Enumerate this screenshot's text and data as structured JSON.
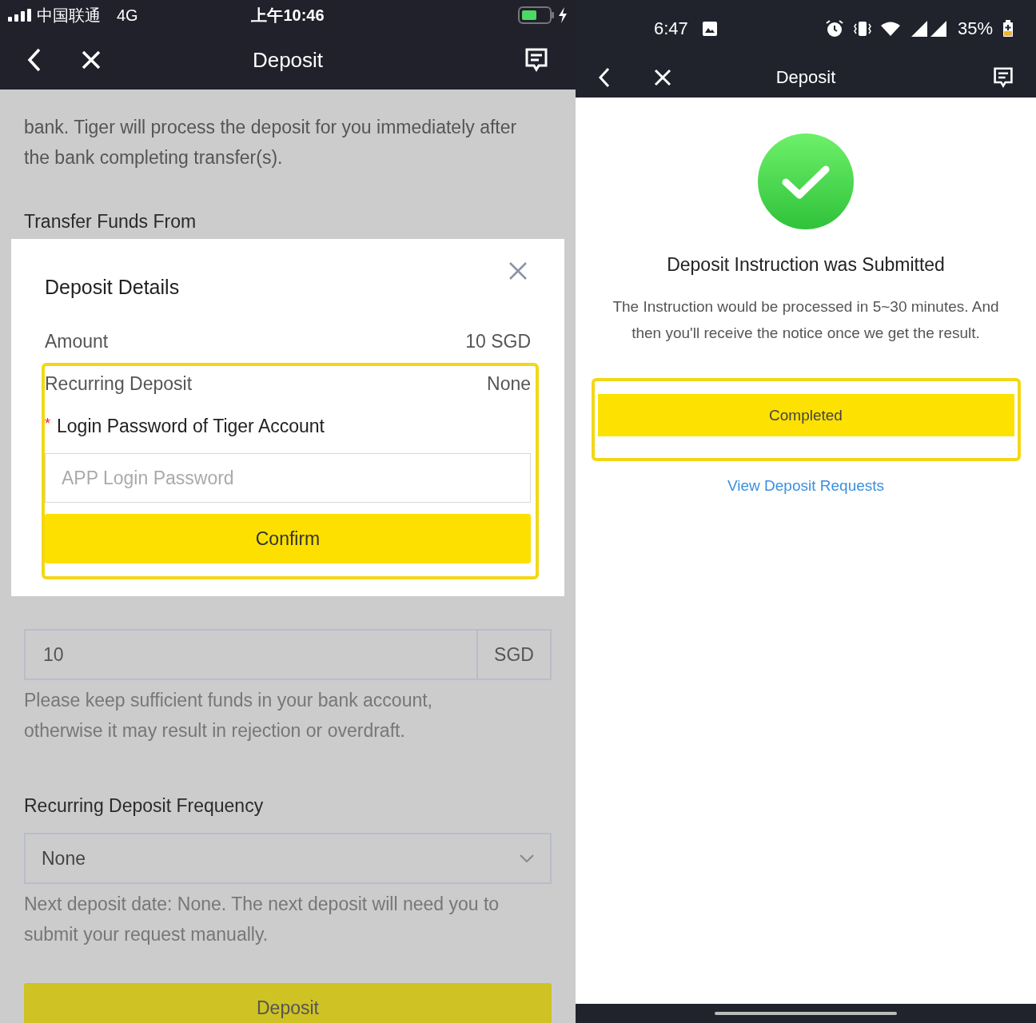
{
  "left_screen": {
    "status_bar": {
      "carrier": "中国联通",
      "network": "4G",
      "time": "上午10:46"
    },
    "header": {
      "title": "Deposit"
    },
    "form": {
      "intro": "bank. Tiger will process the deposit for you immediately after the bank completing transfer(s).",
      "transfer_label": "Transfer Funds From",
      "amount_field": {
        "value": "10",
        "unit": "SGD"
      },
      "amount_hint": "Please keep sufficient funds in your bank account, otherwise it may result in rejection or overdraft.",
      "frequency_label": "Recurring Deposit Frequency",
      "frequency_select": {
        "value": "None"
      },
      "frequency_hint": "Next deposit date: None. The next deposit will need you to submit your request manually.",
      "deposit_button": "Deposit"
    },
    "dialog": {
      "title": "Deposit Details",
      "rows": [
        {
          "label": "Amount",
          "value": "10 SGD"
        },
        {
          "label": "Recurring Deposit",
          "value": "None"
        }
      ],
      "required_mark": "*",
      "password_label": "Login Password of Tiger Account",
      "password_field": {
        "placeholder": "APP Login Password"
      },
      "confirm_button": "Confirm"
    }
  },
  "right_screen": {
    "status_bar": {
      "time": "6:47",
      "battery": "35%"
    },
    "header": {
      "title": "Deposit"
    },
    "result": {
      "title": "Deposit Instruction was Submitted",
      "message": "The Instruction would be processed in 5~30 minutes. And then you'll receive the notice once we get the result.",
      "completed_button": "Completed",
      "link": "View Deposit Requests"
    }
  }
}
